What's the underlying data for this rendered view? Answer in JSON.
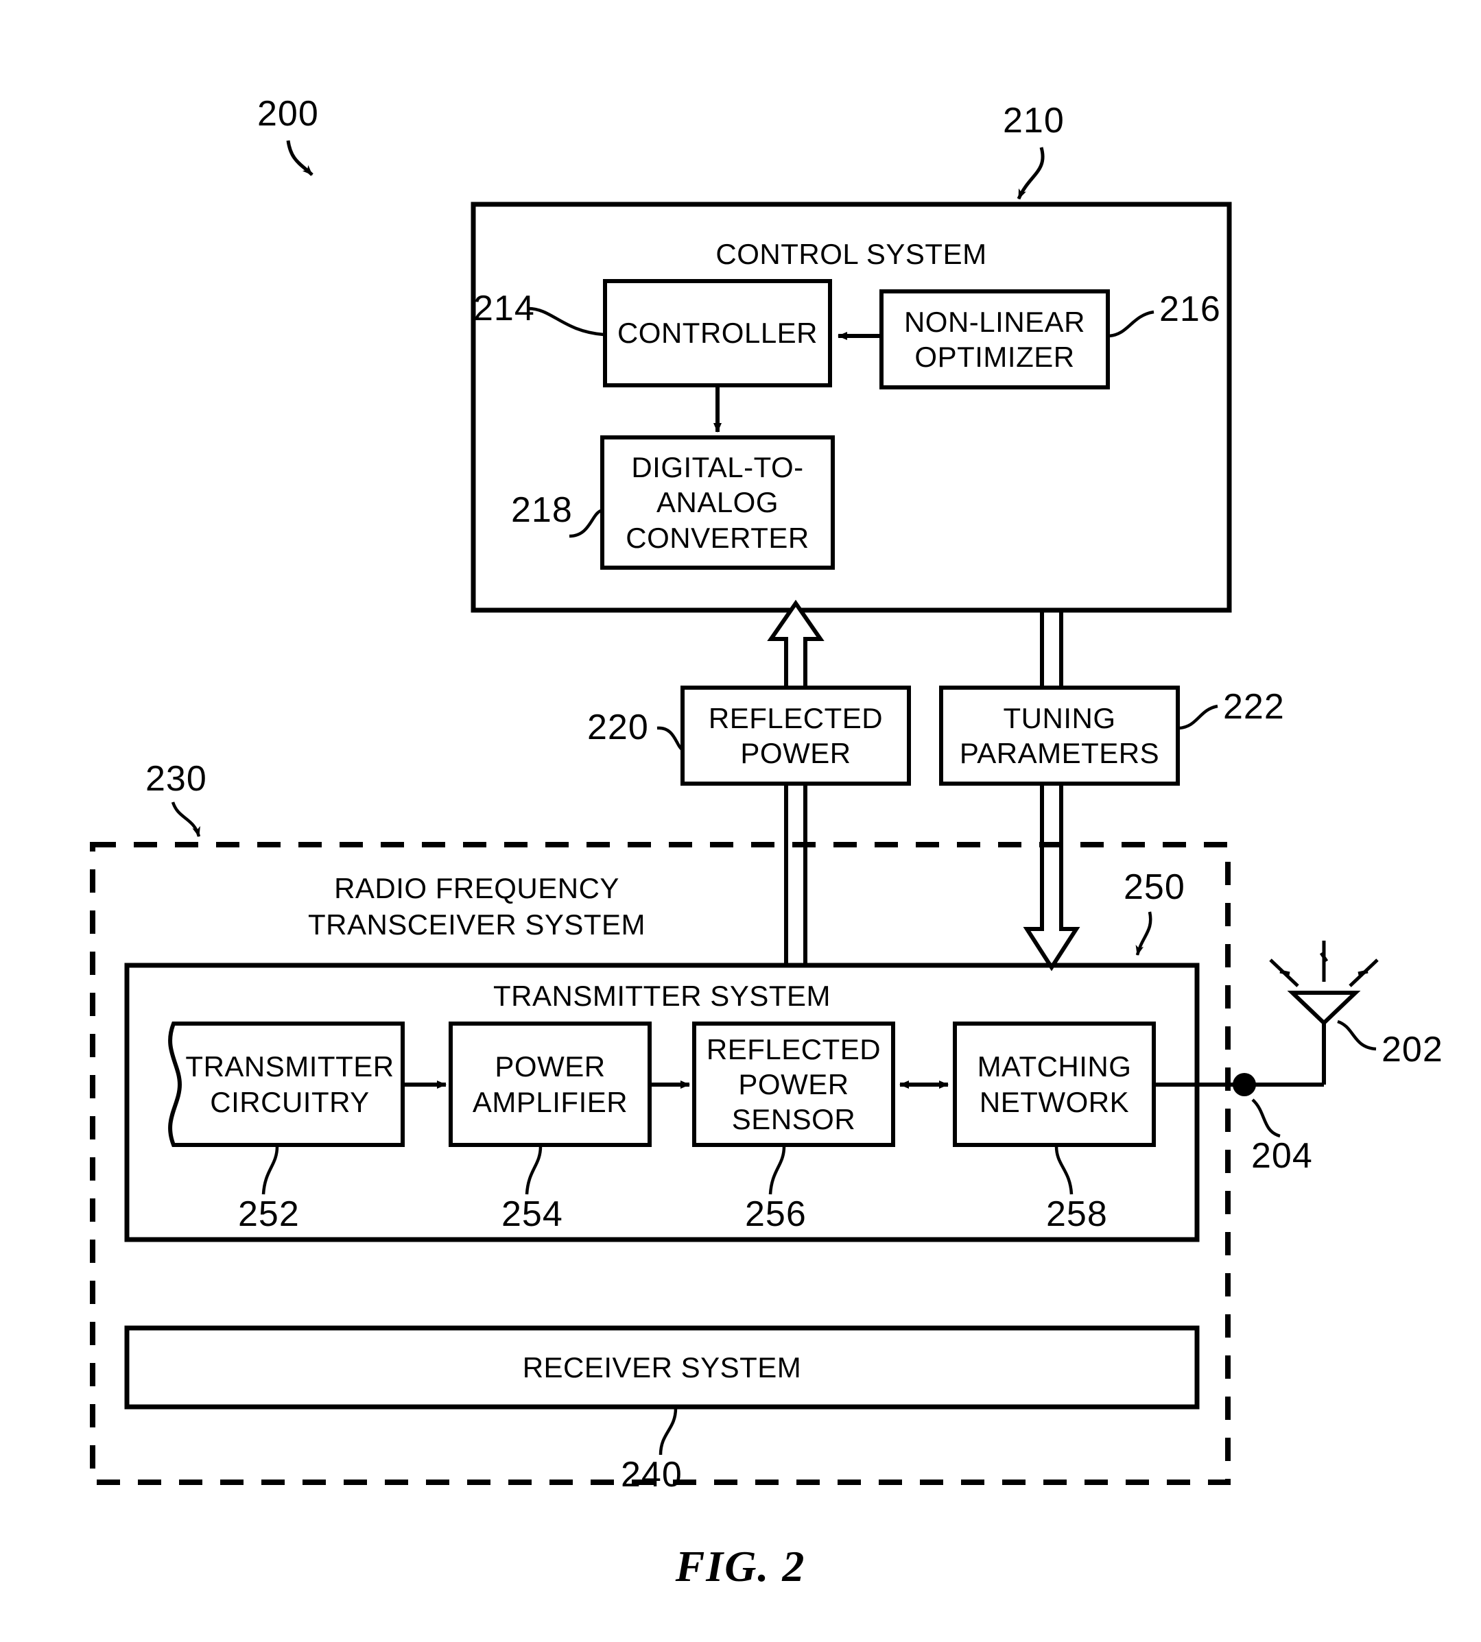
{
  "figure": {
    "caption": "FIG. 2",
    "overall_ref": "200"
  },
  "control_system": {
    "title": "CONTROL SYSTEM",
    "ref": "210",
    "blocks": [
      {
        "label": "CONTROLLER",
        "ref": "214"
      },
      {
        "label": "NON-LINEAR\nOPTIMIZER",
        "ref": "216"
      },
      {
        "label": "DIGITAL-TO-\nANALOG\nCONVERTER",
        "ref": "218"
      }
    ]
  },
  "signals": [
    {
      "label": "REFLECTED\nPOWER",
      "ref": "220"
    },
    {
      "label": "TUNING\nPARAMETERS",
      "ref": "222"
    }
  ],
  "rf_transceiver_system": {
    "title": "RADIO FREQUENCY\nTRANSCEIVER SYSTEM",
    "ref": "230"
  },
  "transmitter_system": {
    "title": "TRANSMITTER SYSTEM",
    "ref": "250",
    "blocks": [
      {
        "label": "TRANSMITTER\nCIRCUITRY",
        "ref": "252"
      },
      {
        "label": "POWER\nAMPLIFIER",
        "ref": "254"
      },
      {
        "label": "REFLECTED\nPOWER\nSENSOR",
        "ref": "256"
      },
      {
        "label": "MATCHING\nNETWORK",
        "ref": "258"
      }
    ]
  },
  "receiver_system": {
    "title": "RECEIVER SYSTEM",
    "ref": "240"
  },
  "antenna": {
    "ref": "202",
    "node_ref": "204"
  },
  "colors": {
    "stroke": "#000000",
    "background": "#ffffff"
  }
}
